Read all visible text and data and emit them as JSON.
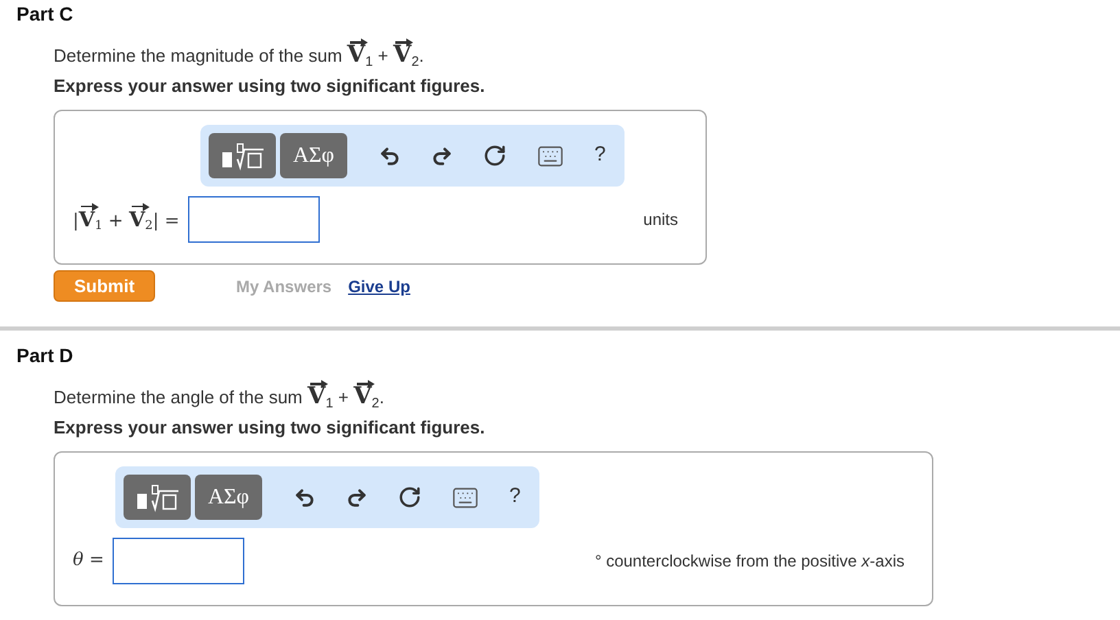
{
  "parts": [
    {
      "title": "Part C",
      "prompt": "Determine the magnitude of the sum **V**$_{1}$ + **V**$_{2}$.",
      "instruction": "Express your answer using two significant figures.",
      "toolbar": {
        "symbols_label": "ΑΣφ",
        "help_label": "?"
      },
      "answer_label": "|**V**$_{1}$ + **V**$_{2}$| =",
      "unit": "units",
      "actions": {
        "submit": "Submit",
        "my_answers": "My Answers",
        "give_up": "Give Up"
      }
    },
    {
      "title": "Part D",
      "prompt": "Determine the angle of the sum **V**$_{1}$ + **V**$_{2}$.",
      "instruction": "Express your answer using two significant figures.",
      "toolbar": {
        "symbols_label": "ΑΣφ",
        "help_label": "?"
      },
      "answer_label": "*θ* =",
      "unit": "° counterclockwise from the positive *x*-axis"
    }
  ]
}
